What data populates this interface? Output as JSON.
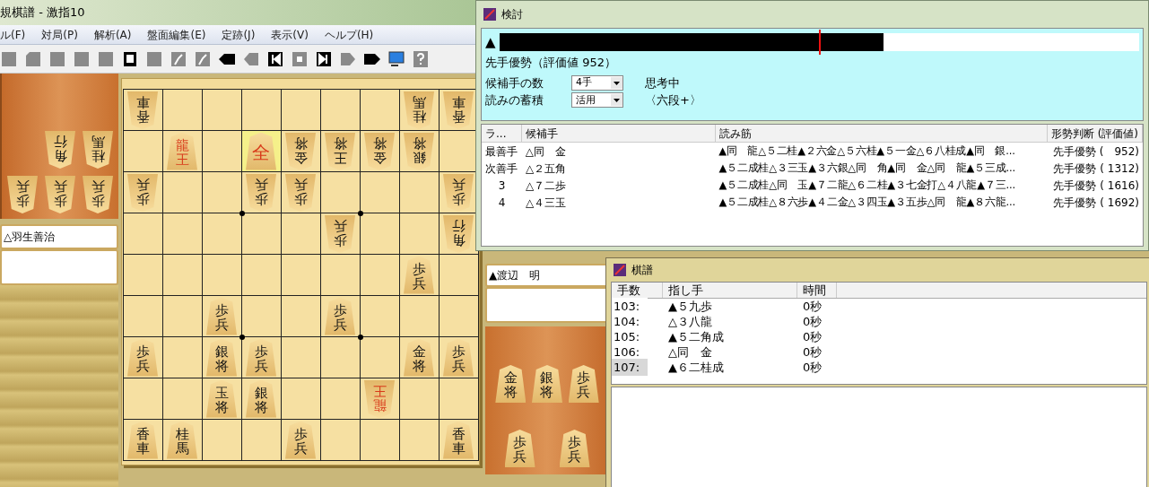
{
  "window": {
    "title": "規棋譜 - 激指10"
  },
  "menu": [
    "ル(F)",
    "対局(P)",
    "解析(A)",
    "盤面編集(E)",
    "定跡(J)",
    "表示(V)",
    "ヘルプ(H)"
  ],
  "players": {
    "gote": "△羽生善治",
    "sente": "▲渡辺　明"
  },
  "gote_hand": [
    {
      "piece": "歩兵"
    },
    {
      "piece": "歩兵"
    },
    {
      "piece": "歩兵"
    },
    {
      "piece": "桂馬"
    },
    {
      "piece": "角行"
    }
  ],
  "sente_hand": [
    {
      "piece": "金将"
    },
    {
      "piece": "銀将"
    },
    {
      "piece": "歩兵"
    },
    {
      "piece": "歩兵"
    },
    {
      "piece": "歩兵"
    }
  ],
  "board": {
    "rows": [
      [
        {
          "piece": "香車",
          "gote": true,
          "promoted": false,
          "highlighted": false
        },
        {
          "highlighted": false
        },
        {
          "highlighted": false
        },
        {
          "highlighted": false
        },
        {
          "highlighted": false
        },
        {
          "highlighted": false
        },
        {
          "highlighted": false
        },
        {
          "piece": "桂馬",
          "gote": true,
          "promoted": false,
          "highlighted": false
        },
        {
          "piece": "香車",
          "gote": true,
          "promoted": false,
          "highlighted": false
        }
      ],
      [
        {
          "highlighted": false
        },
        {
          "piece": "龍王",
          "gote": false,
          "promoted": true,
          "highlighted": false
        },
        {
          "highlighted": false
        },
        {
          "piece": "全",
          "gote": false,
          "promoted": true,
          "highlighted": true
        },
        {
          "piece": "金将",
          "gote": true,
          "promoted": false,
          "highlighted": false
        },
        {
          "piece": "王将",
          "gote": true,
          "promoted": false,
          "highlighted": false
        },
        {
          "piece": "金将",
          "gote": true,
          "promoted": false,
          "highlighted": false
        },
        {
          "piece": "銀将",
          "gote": true,
          "promoted": false,
          "highlighted": false
        },
        {
          "highlighted": false
        }
      ],
      [
        {
          "piece": "歩兵",
          "gote": true,
          "promoted": false,
          "highlighted": false
        },
        {
          "highlighted": false
        },
        {
          "highlighted": false
        },
        {
          "piece": "歩兵",
          "gote": true,
          "promoted": false,
          "highlighted": false
        },
        {
          "piece": "歩兵",
          "gote": true,
          "promoted": false,
          "highlighted": false
        },
        {
          "highlighted": false
        },
        {
          "highlighted": false
        },
        {
          "highlighted": false
        },
        {
          "piece": "歩兵",
          "gote": true,
          "promoted": false,
          "highlighted": false
        }
      ],
      [
        {
          "highlighted": false
        },
        {
          "highlighted": false
        },
        {
          "highlighted": false
        },
        {
          "highlighted": false
        },
        {
          "highlighted": false
        },
        {
          "piece": "歩兵",
          "gote": true,
          "promoted": false,
          "highlighted": false
        },
        {
          "highlighted": false
        },
        {
          "highlighted": false
        },
        {
          "piece": "角行",
          "gote": true,
          "promoted": false,
          "highlighted": false
        }
      ],
      [
        {
          "highlighted": false
        },
        {
          "highlighted": false
        },
        {
          "highlighted": false
        },
        {
          "highlighted": false
        },
        {
          "highlighted": false
        },
        {
          "highlighted": false
        },
        {
          "highlighted": false
        },
        {
          "piece": "歩兵",
          "gote": false,
          "promoted": false,
          "highlighted": false
        },
        {
          "highlighted": false
        }
      ],
      [
        {
          "highlighted": false
        },
        {
          "highlighted": false
        },
        {
          "piece": "歩兵",
          "gote": false,
          "promoted": false,
          "highlighted": false
        },
        {
          "highlighted": false
        },
        {
          "highlighted": false
        },
        {
          "piece": "歩兵",
          "gote": false,
          "promoted": false,
          "highlighted": false
        },
        {
          "highlighted": false
        },
        {
          "highlighted": false
        },
        {
          "highlighted": false
        }
      ],
      [
        {
          "piece": "歩兵",
          "gote": false,
          "promoted": false,
          "highlighted": false
        },
        {
          "highlighted": false
        },
        {
          "piece": "銀将",
          "gote": false,
          "promoted": false,
          "highlighted": false
        },
        {
          "piece": "歩兵",
          "gote": false,
          "promoted": false,
          "highlighted": false
        },
        {
          "highlighted": false
        },
        {
          "highlighted": false
        },
        {
          "highlighted": false
        },
        {
          "piece": "金将",
          "gote": false,
          "promoted": false,
          "highlighted": false
        },
        {
          "piece": "歩兵",
          "gote": false,
          "promoted": false,
          "highlighted": false
        }
      ],
      [
        {
          "highlighted": false
        },
        {
          "highlighted": false
        },
        {
          "piece": "玉将",
          "gote": false,
          "promoted": false,
          "highlighted": false
        },
        {
          "piece": "銀将",
          "gote": false,
          "promoted": false,
          "highlighted": false
        },
        {
          "highlighted": false
        },
        {
          "highlighted": false
        },
        {
          "piece": "龍王",
          "gote": true,
          "promoted": true,
          "highlighted": false
        },
        {
          "highlighted": false
        },
        {
          "highlighted": false
        }
      ],
      [
        {
          "piece": "香車",
          "gote": false,
          "promoted": false,
          "highlighted": false
        },
        {
          "piece": "桂馬",
          "gote": false,
          "promoted": false,
          "highlighted": false
        },
        {
          "highlighted": false
        },
        {
          "highlighted": false
        },
        {
          "piece": "歩兵",
          "gote": false,
          "promoted": false,
          "highlighted": false
        },
        {
          "highlighted": false
        },
        {
          "highlighted": false
        },
        {
          "highlighted": false
        },
        {
          "piece": "香車",
          "gote": false,
          "promoted": false,
          "highlighted": false
        }
      ]
    ]
  },
  "analysis": {
    "title": "検討",
    "side_mark": "▲",
    "eval_bar": {
      "level": 0.6
    },
    "verdict": "先手優勢（評価値 952）",
    "candidates_label": "候補手の数",
    "candidates_value": "4手",
    "status": "思考中",
    "accum_label": "読みの蓄積",
    "accum_value": "活用",
    "strength": "〈六段+〉",
    "columns": [
      "ラ...",
      "候補手",
      "読み筋",
      "形勢判断 (評価値)"
    ],
    "rows": [
      {
        "rank": "最善手",
        "move": "△同　金",
        "line": "▲同　龍△５二桂▲２六金△５六桂▲５一金△６八桂成▲同　銀...",
        "judgment": "先手優勢 (　952)"
      },
      {
        "rank": "次善手",
        "move": "△２五角",
        "line": "▲５二成桂△３三玉▲３六銀△同　角▲同　金△同　龍▲５三成...",
        "judgment": "先手優勢 ( 1312)"
      },
      {
        "rank": "3",
        "move": "△７二歩",
        "line": "▲５二成桂△同　玉▲７二龍△６二桂▲３七金打△４八龍▲７三...",
        "judgment": "先手優勢 ( 1616)"
      },
      {
        "rank": "4",
        "move": "△４三玉",
        "line": "▲５二成桂△８六歩▲４二金△３四玉▲３五歩△同　龍▲８六龍...",
        "judgment": "先手優勢 ( 1692)"
      }
    ]
  },
  "kifu": {
    "title": "棋譜",
    "columns": [
      "手数",
      "指し手",
      "時間"
    ],
    "rows": [
      {
        "number": "103:",
        "move": "▲５九歩",
        "time": "0秒",
        "selected": false
      },
      {
        "number": "104:",
        "move": "△３八龍",
        "time": "0秒",
        "selected": false
      },
      {
        "number": "105:",
        "move": "▲５二角成",
        "time": "0秒",
        "selected": false
      },
      {
        "number": "106:",
        "move": "△同　金",
        "time": "0秒",
        "selected": false
      },
      {
        "number": "107:",
        "move": "▲６二桂成",
        "time": "0秒",
        "selected": true
      }
    ]
  }
}
